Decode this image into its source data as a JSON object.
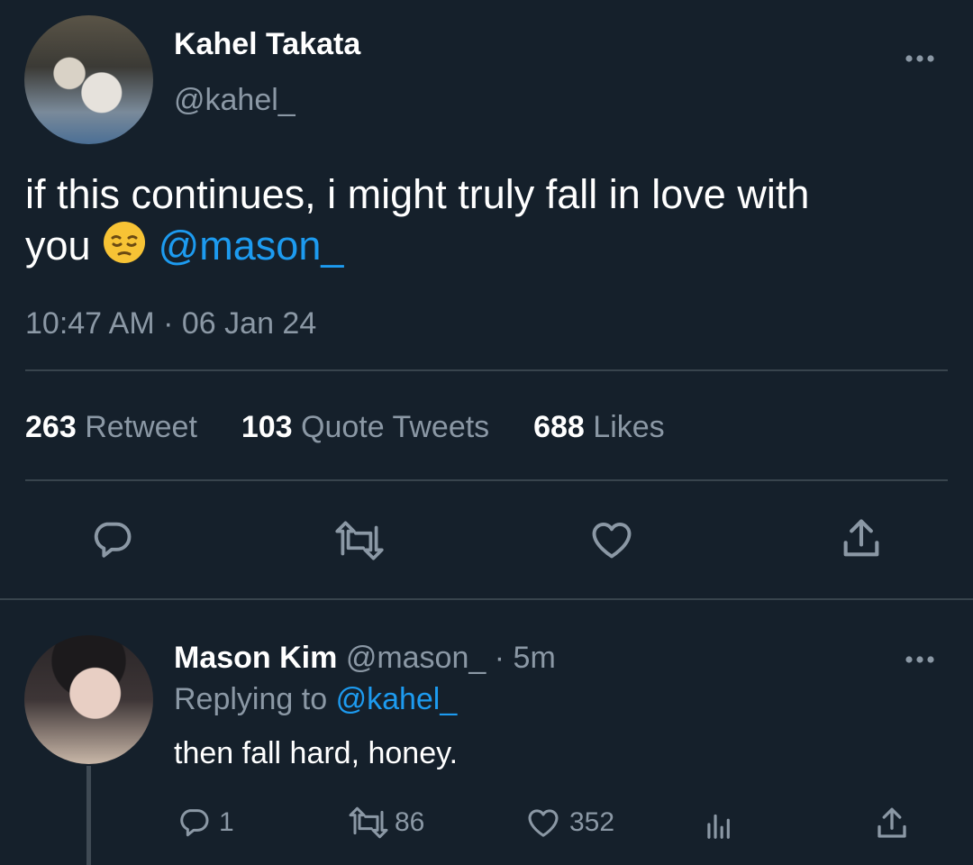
{
  "tweet": {
    "author_name": "Kahel Takata",
    "author_handle": "@kahel_",
    "text_line1": "if this continues, i might truly fall in love with",
    "text_line2_prefix": "you",
    "emoji": "pensive-face",
    "mention": "@mason_",
    "time": "10:47 AM",
    "date_sep": "·",
    "date": "06 Jan 24",
    "stats": {
      "retweets_count": "263",
      "retweets_label": "Retweet",
      "quotes_count": "103",
      "quotes_label": "Quote Tweets",
      "likes_count": "688",
      "likes_label": "Likes"
    },
    "actions": [
      "reply-icon",
      "retweet-icon",
      "like-icon",
      "share-icon"
    ]
  },
  "reply": {
    "author_name": "Mason Kim",
    "author_handle": "@mason_",
    "sep": "·",
    "age": "5m",
    "replying_prefix": "Replying to",
    "replying_handle": "@kahel_",
    "text": "then fall hard, honey.",
    "reply_count": "1",
    "retweet_count": "86",
    "like_count": "352"
  },
  "colors": {
    "background": "#15202b",
    "text": "#ffffff",
    "secondary": "#8b98a5",
    "link": "#1d9bf0",
    "divider": "#38444d"
  }
}
